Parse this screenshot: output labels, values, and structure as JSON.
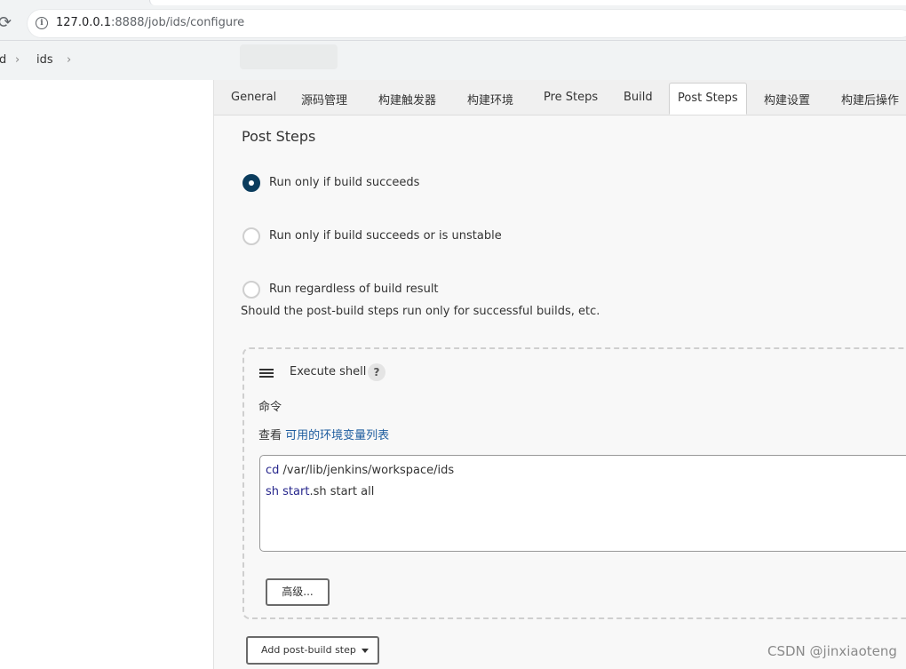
{
  "browser": {
    "url_host": "127.0.0.1",
    "url_path": ":8888/job/ids/configure",
    "reload_glyph": "⟳",
    "info_glyph": "i"
  },
  "breadcrumb": {
    "items": [
      "d",
      "ids"
    ],
    "separator": "›"
  },
  "tabs": [
    {
      "label": "General"
    },
    {
      "label": "源码管理"
    },
    {
      "label": "构建触发器"
    },
    {
      "label": "构建环境"
    },
    {
      "label": "Pre Steps"
    },
    {
      "label": "Build"
    },
    {
      "label": "Post Steps",
      "active": true
    },
    {
      "label": "构建设置"
    },
    {
      "label": "构建后操作"
    }
  ],
  "section": {
    "title": "Post Steps",
    "options": [
      {
        "label": "Run only if build succeeds",
        "checked": true
      },
      {
        "label": "Run only if build succeeds or is unstable",
        "checked": false
      },
      {
        "label": "Run regardless of build result",
        "checked": false
      }
    ],
    "help": "Should the post-build steps run only for successful builds, etc."
  },
  "step": {
    "title": "Execute shell",
    "help_glyph": "?",
    "command_label": "命令",
    "env_prefix": "查看",
    "env_link": "可用的环境变量列表",
    "command_lines": [
      {
        "kw": "cd",
        "rest": " /var/lib/jenkins/workspace/ids"
      },
      {
        "kw": "sh start",
        "rest": ".sh start all"
      }
    ],
    "advanced_label": "高级..."
  },
  "add_step_label": "Add post-build step",
  "watermark": "CSDN @jinxiaoteng",
  "colors": {
    "accent": "#0b3c5d",
    "link": "#1d5c9e"
  }
}
